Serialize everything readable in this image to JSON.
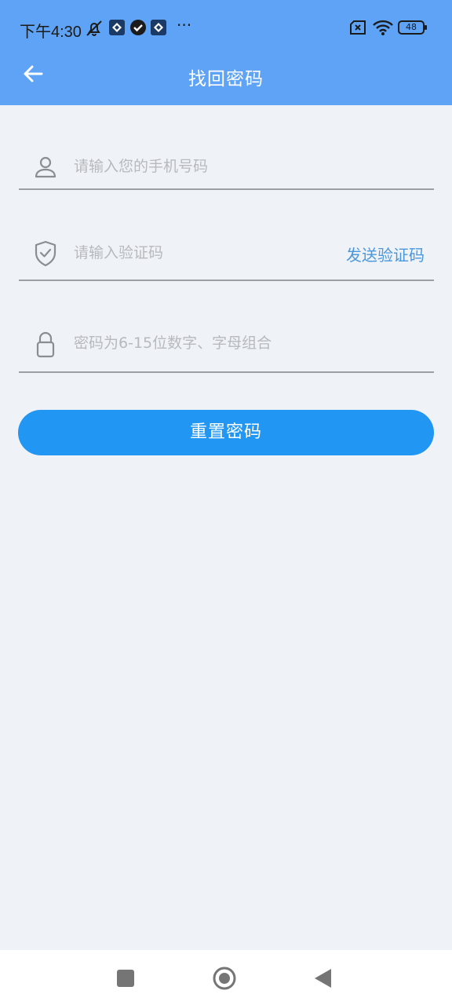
{
  "status_bar": {
    "time": "下午4:30",
    "more_label": "···",
    "battery_level": "48"
  },
  "header": {
    "title": "找回密码",
    "background": "#5ea3f6"
  },
  "form": {
    "phone": {
      "placeholder": "请输入您的手机号码",
      "icon": "user-icon"
    },
    "code": {
      "placeholder": "请输入验证码",
      "icon": "shield-check-icon",
      "send_label": "发送验证码"
    },
    "password": {
      "placeholder": "密码为6-15位数字、字母组合",
      "icon": "lock-icon"
    },
    "submit_label": "重置密码",
    "accent": "#2196f3",
    "link_color": "#4a97dc"
  },
  "bottom_nav": {
    "items": [
      "recents-square-icon",
      "home-circle-icon",
      "back-triangle-icon"
    ]
  }
}
